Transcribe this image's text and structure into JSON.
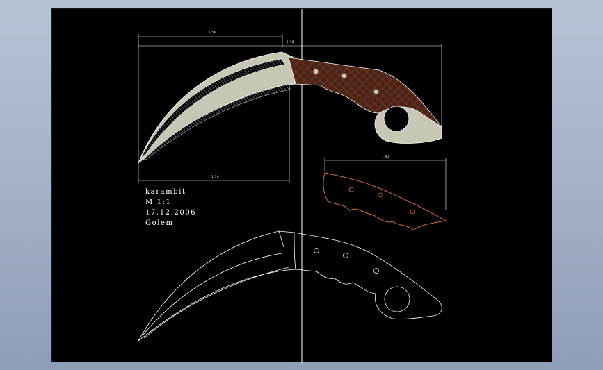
{
  "title_block": {
    "name": "karambit",
    "scale": "M 1:1",
    "date": "17.12.2006",
    "author": "Golem"
  },
  "dimensions": {
    "blade_top": "1.56",
    "overall": "5.18",
    "blade_bottom": "1.56",
    "handle_width": "1.91"
  },
  "colors": {
    "background": "#000000",
    "lines": "#ffffff",
    "blade_fill": "#c8c7b6",
    "handle_fill": "#4a2418",
    "handle_hatch": "#b8552f",
    "handle_outline": "#d86a3c",
    "window_bg": "#a9b4c9"
  }
}
